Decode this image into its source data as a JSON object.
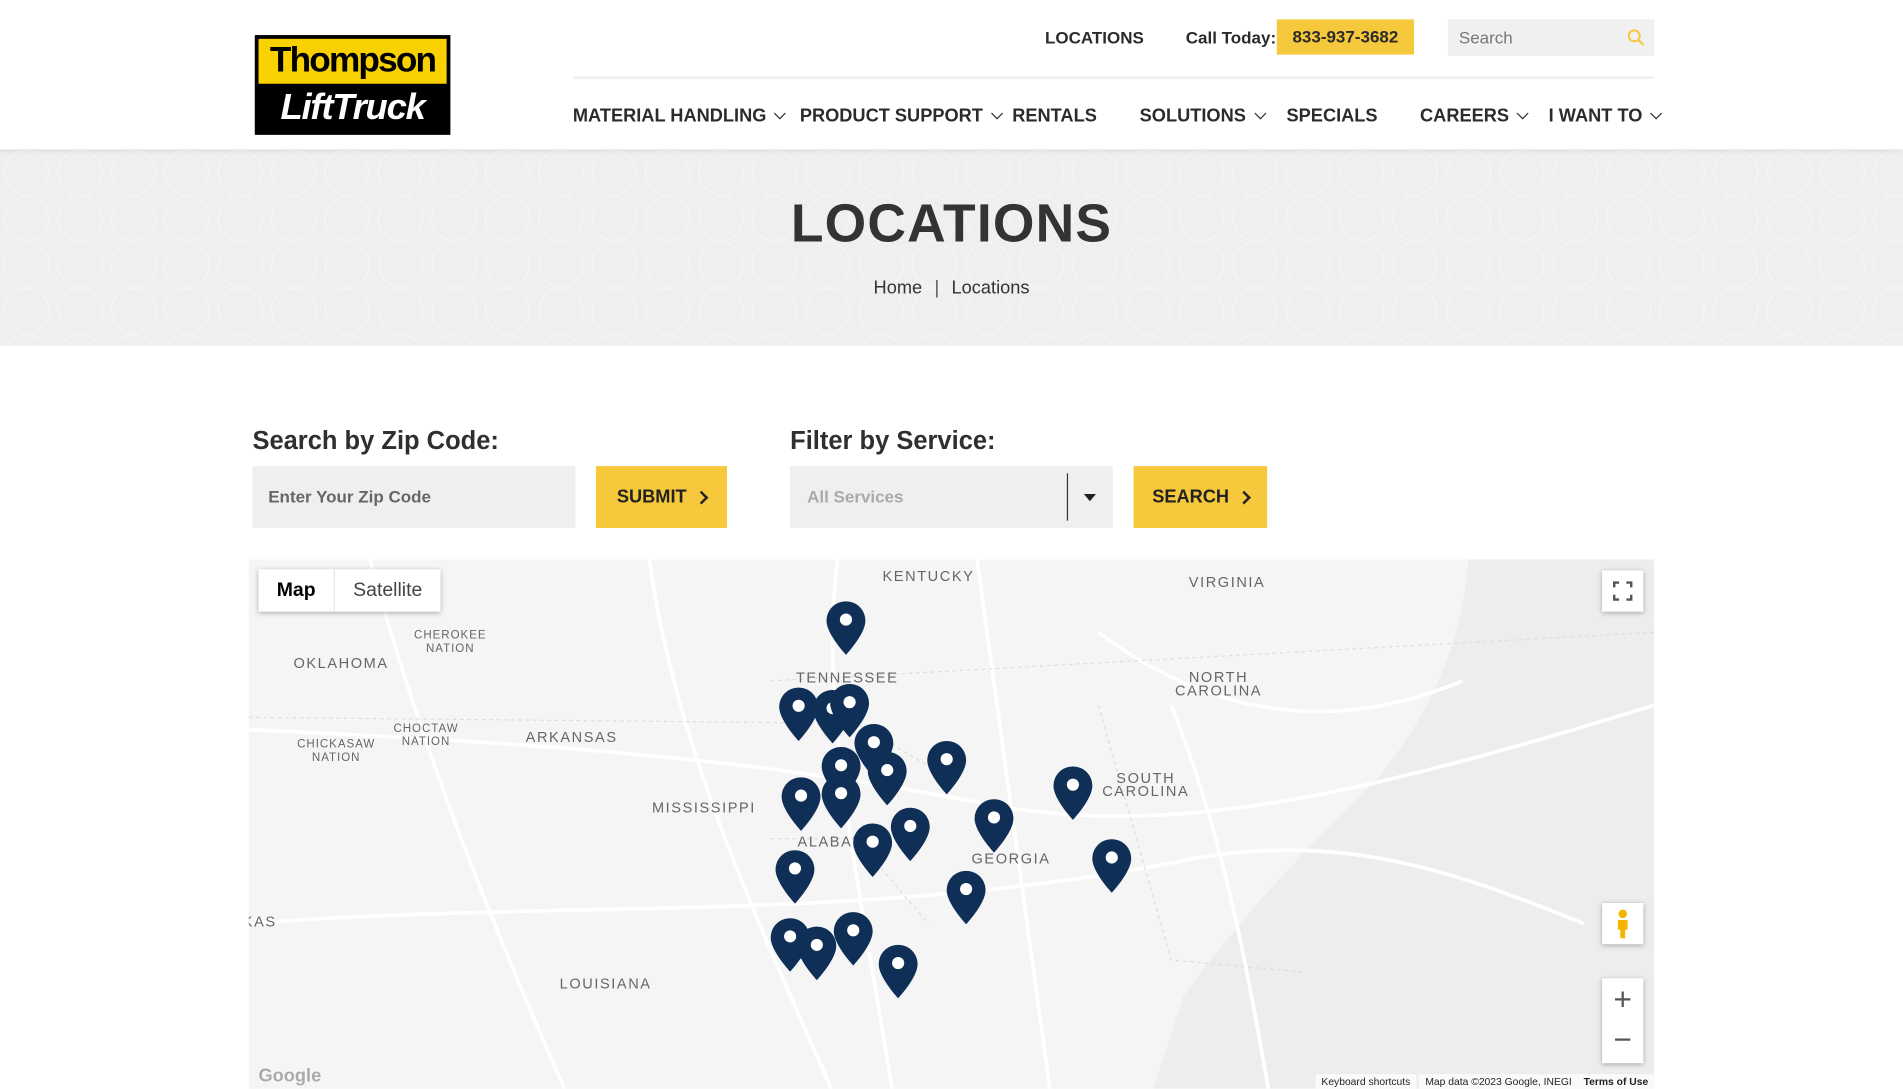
{
  "header": {
    "logo": {
      "line1": "Thompson",
      "line2": "LiftTruck"
    },
    "top_links": {
      "locations": "LOCATIONS",
      "call_label": "Call Today:",
      "phone": "833-937-3682"
    },
    "search": {
      "placeholder": "Search",
      "icon": "search-icon"
    },
    "nav": [
      {
        "label": "MATERIAL HANDLING",
        "dropdown": true
      },
      {
        "label": "PRODUCT SUPPORT",
        "dropdown": true
      },
      {
        "label": "RENTALS",
        "dropdown": false
      },
      {
        "label": "SOLUTIONS",
        "dropdown": true
      },
      {
        "label": "SPECIALS",
        "dropdown": false
      },
      {
        "label": "CAREERS",
        "dropdown": true
      },
      {
        "label": "I WANT TO",
        "dropdown": true
      }
    ]
  },
  "banner": {
    "title": "LOCATIONS",
    "breadcrumb": [
      "Home",
      "Locations"
    ]
  },
  "zip_search": {
    "label": "Search by Zip Code:",
    "placeholder": "Enter Your Zip Code",
    "button": "SUBMIT"
  },
  "service_filter": {
    "label": "Filter by Service:",
    "selected": "All Services",
    "button": "SEARCH"
  },
  "map": {
    "type_buttons": [
      "Map",
      "Satellite"
    ],
    "selected_type": "Map",
    "labels": [
      "KENTUCKY",
      "VIRGINIA",
      "OKLAHOMA",
      "CHEROKEE\nNATION",
      "TENNESSEE",
      "NORTH\nCAROLINA",
      "CHICKASAW\nNATION",
      "CHOCTAW\nNATION",
      "ARKANSAS",
      "SOUTH\nCAROLINA",
      "MISSISSIPPI",
      "ALABAMA",
      "GEORGIA",
      "KAS",
      "LOUISIANA"
    ],
    "marker_count": 21,
    "marker_color": "#0f2f57",
    "footer": {
      "google": "Google",
      "shortcuts": "Keyboard shortcuts",
      "map_data": "Map data ©2023 Google, INEGI",
      "terms": "Terms of Use"
    }
  },
  "colors": {
    "accent": "#f6c83b",
    "logo_yellow": "#f9d100",
    "text": "#2b2b2b",
    "marker": "#0f2f57"
  }
}
